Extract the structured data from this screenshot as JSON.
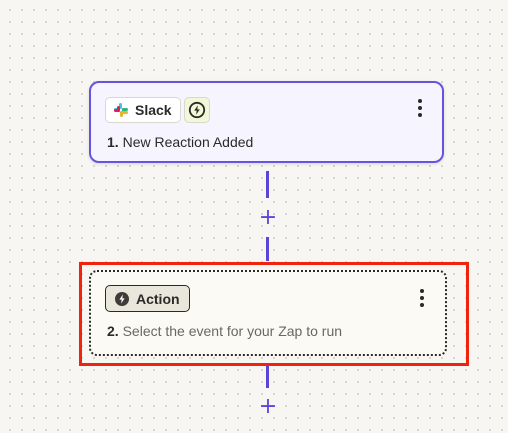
{
  "trigger": {
    "app_label": "Slack",
    "app_icon": "slack-logo-icon",
    "badge_icon": "lightning-bolt-icon",
    "step_number": "1.",
    "step_title": "New Reaction Added",
    "menu_icon": "kebab-menu-icon"
  },
  "action": {
    "chip_label": "Action",
    "chip_icon": "lightning-bolt-icon",
    "step_number": "2.",
    "step_title": "Select the event for your Zap to run",
    "menu_icon": "kebab-menu-icon"
  },
  "connectors": {
    "add_step_glyph": "+"
  },
  "colors": {
    "accent": "#5b45d8",
    "trigger_border": "#6653e0",
    "highlight": "#f0240e",
    "trigger_badge_bg": "#f2f7d8"
  }
}
